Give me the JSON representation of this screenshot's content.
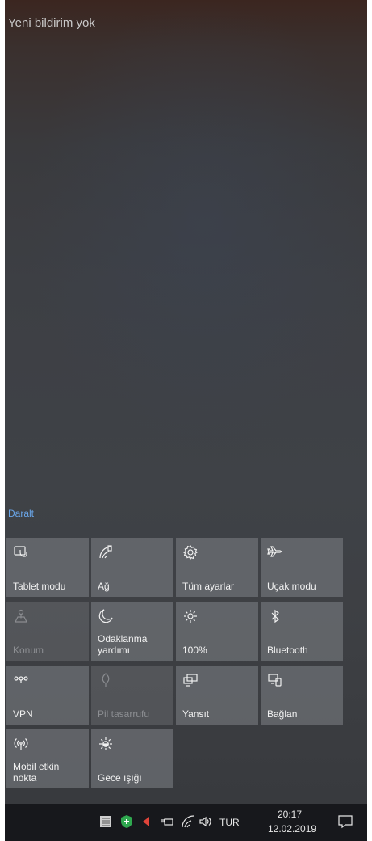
{
  "notifications": {
    "empty_text": "Yeni bildirim yok"
  },
  "collapse_label": "Daralt",
  "tiles": [
    {
      "label": "Tablet modu",
      "icon": "tablet-mode-icon",
      "enabled": true
    },
    {
      "label": "Ağ",
      "icon": "network-icon",
      "enabled": true
    },
    {
      "label": "Tüm ayarlar",
      "icon": "settings-gear-icon",
      "enabled": true
    },
    {
      "label": "Uçak modu",
      "icon": "airplane-icon",
      "enabled": true
    },
    {
      "label": "Konum",
      "icon": "location-icon",
      "enabled": false
    },
    {
      "label": "Odaklanma yardımı",
      "icon": "moon-icon",
      "enabled": true
    },
    {
      "label": "100%",
      "icon": "brightness-icon",
      "enabled": true
    },
    {
      "label": "Bluetooth",
      "icon": "bluetooth-icon",
      "enabled": true
    },
    {
      "label": "VPN",
      "icon": "vpn-icon",
      "enabled": true
    },
    {
      "label": "Pil tasarrufu",
      "icon": "battery-saver-icon",
      "enabled": false
    },
    {
      "label": "Yansıt",
      "icon": "project-icon",
      "enabled": true
    },
    {
      "label": "Bağlan",
      "icon": "connect-icon",
      "enabled": true
    },
    {
      "label": "Mobil etkin nokta",
      "icon": "mobile-hotspot-icon",
      "enabled": true
    },
    {
      "label": "Gece ışığı",
      "icon": "night-light-icon",
      "enabled": true
    }
  ],
  "taskbar": {
    "language": "TUR",
    "time": "20:17",
    "date": "12.02.2019",
    "icons": [
      "app-icon",
      "security-shield-icon",
      "red-arrow-icon",
      "power-plug-icon",
      "wifi-icon",
      "speaker-icon",
      "action-center-icon"
    ],
    "colors": {
      "shield_green": "#2fa84f",
      "arrow_red": "#e0443a"
    }
  }
}
